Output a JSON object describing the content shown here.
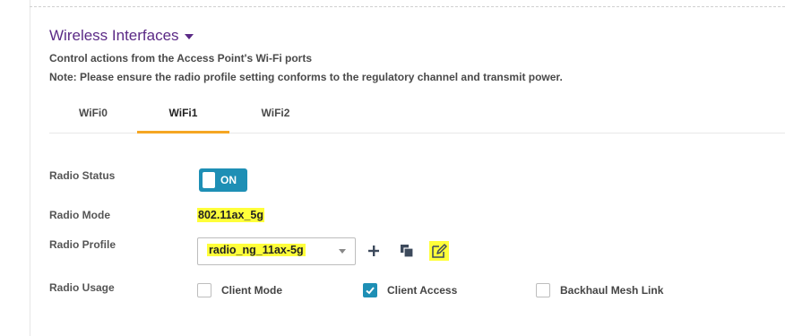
{
  "section": {
    "title": "Wireless Interfaces",
    "desc1": "Control actions from the Access Point's Wi-Fi ports",
    "desc2": "Note: Please ensure the radio profile setting conforms to the regulatory channel and transmit power."
  },
  "tabs": [
    {
      "label": "WiFi0",
      "active": false
    },
    {
      "label": "WiFi1",
      "active": true
    },
    {
      "label": "WiFi2",
      "active": false
    }
  ],
  "form": {
    "radio_status_label": "Radio Status",
    "radio_status_value": "ON",
    "radio_mode_label": "Radio Mode",
    "radio_mode_value": "802.11ax_5g",
    "radio_profile_label": "Radio Profile",
    "radio_profile_value": "radio_ng_11ax-5g",
    "radio_usage_label": "Radio Usage",
    "usage": [
      {
        "label": "Client Mode",
        "checked": false
      },
      {
        "label": "Client Access",
        "checked": true
      },
      {
        "label": "Backhaul Mesh Link",
        "checked": false
      }
    ]
  },
  "icons": {
    "add": "plus-icon",
    "clone": "clone-icon",
    "edit": "edit-icon"
  },
  "colors": {
    "title": "#5b2a86",
    "accent": "#1e8fb5",
    "tab_underline": "#f5a623",
    "highlight": "#ffff3a"
  }
}
